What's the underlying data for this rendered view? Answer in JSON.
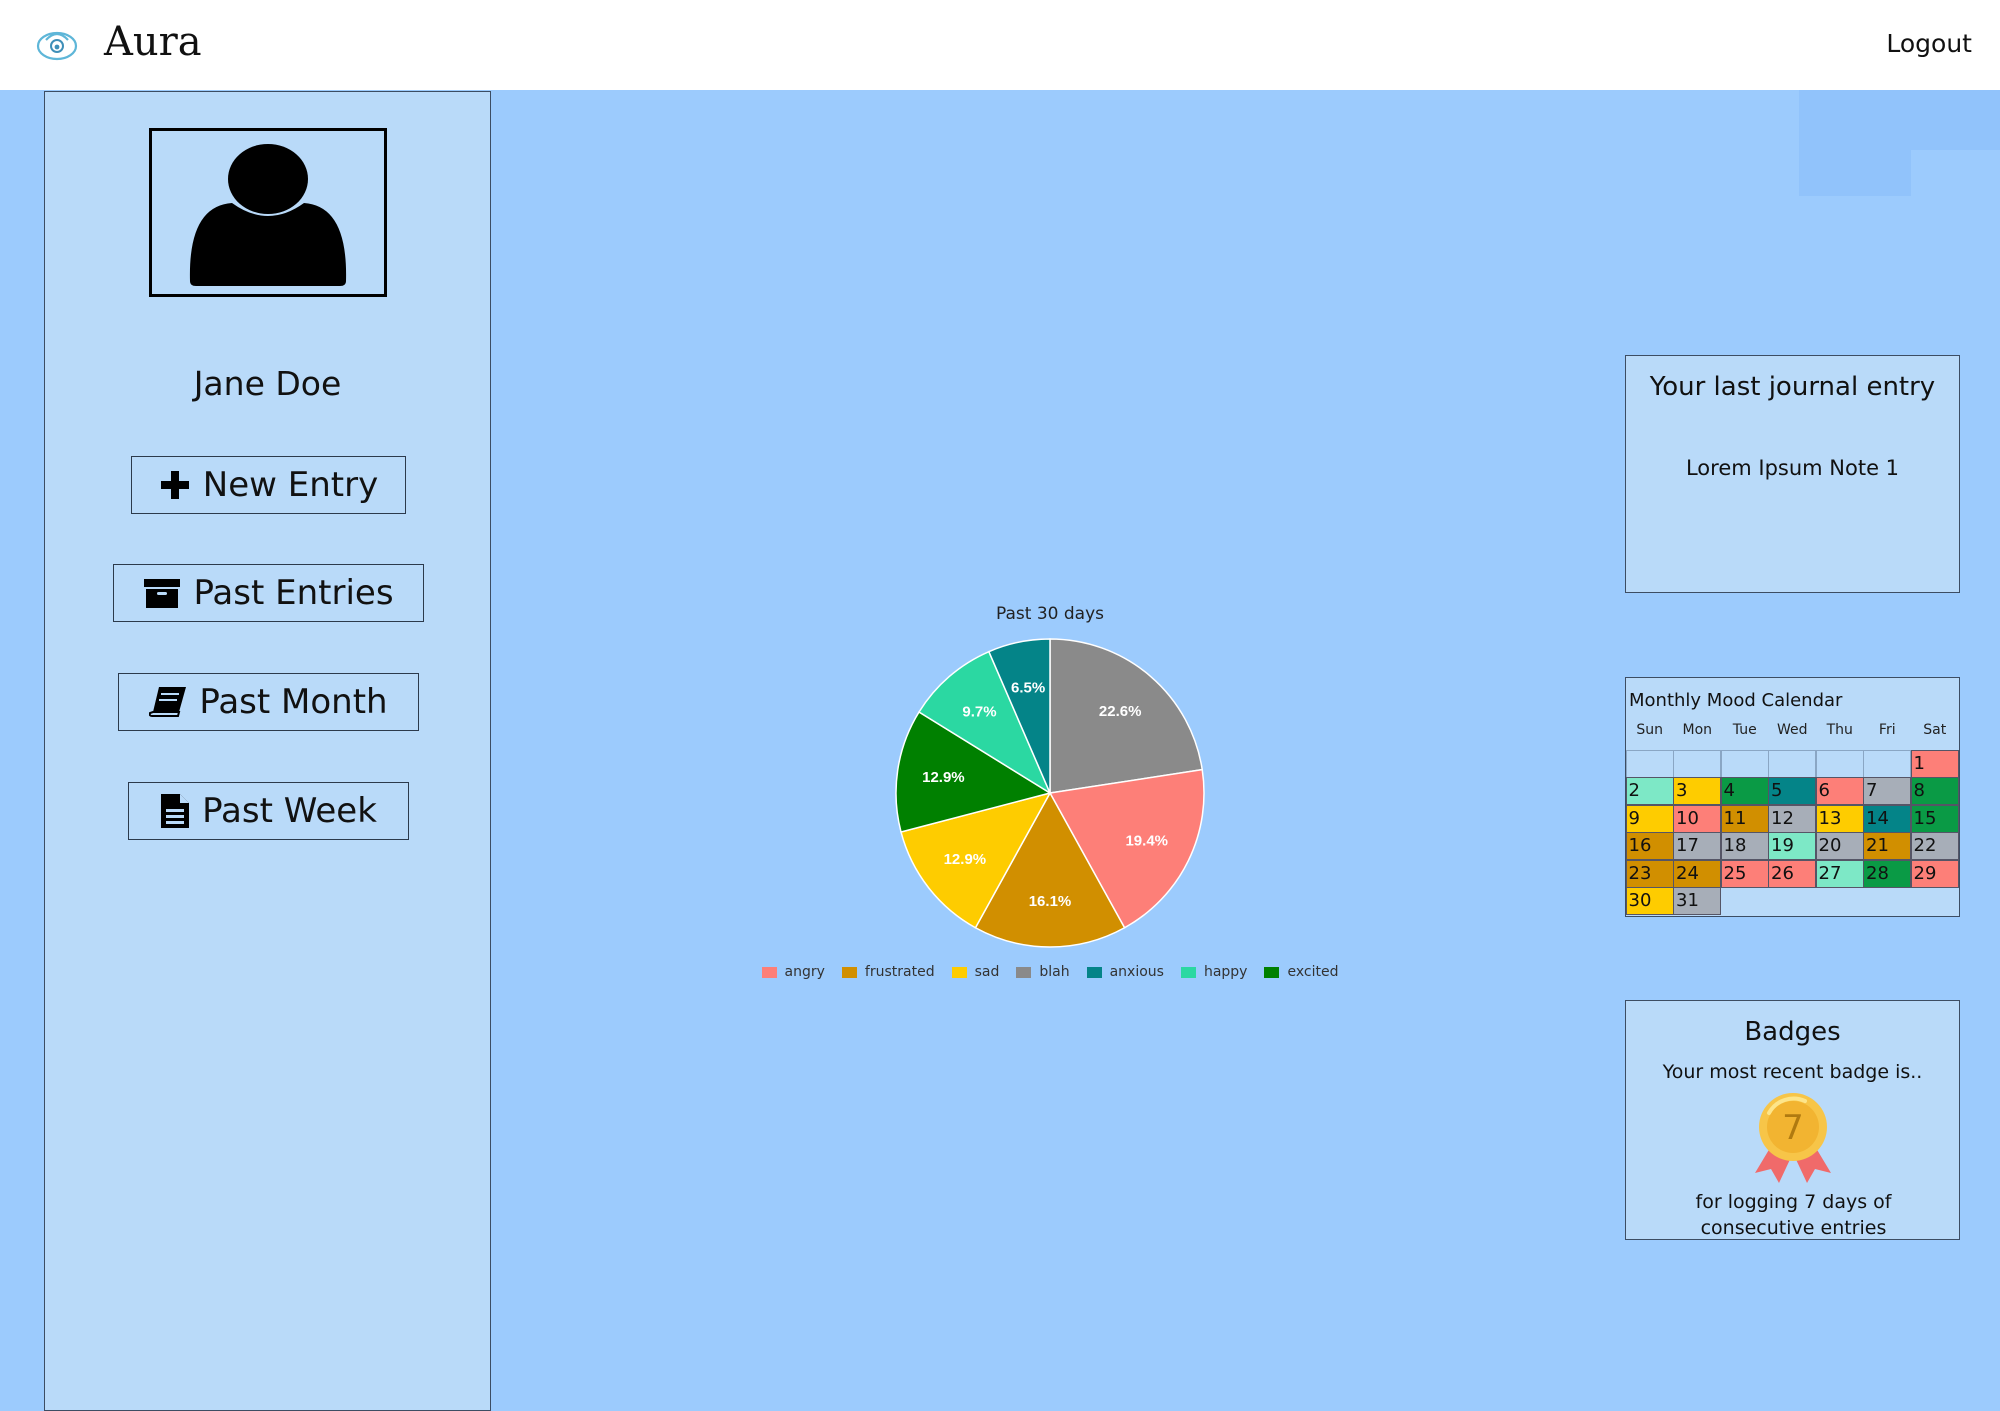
{
  "app": {
    "brand": "Aura",
    "logout_label": "Logout"
  },
  "sidebar": {
    "username": "Jane Doe",
    "nav": [
      {
        "label": "New Entry",
        "icon": "plus-icon"
      },
      {
        "label": "Past Entries",
        "icon": "archive-icon"
      },
      {
        "label": "Past Month",
        "icon": "book-icon"
      },
      {
        "label": "Past Week",
        "icon": "document-icon"
      }
    ]
  },
  "chart_data": {
    "type": "pie",
    "title": "Past 30 days",
    "legend_position": "bottom",
    "categories": [
      "angry",
      "frustrated",
      "sad",
      "blah",
      "anxious",
      "happy",
      "excited"
    ],
    "values": [
      19.4,
      16.1,
      12.9,
      22.6,
      6.5,
      9.7,
      12.9
    ],
    "value_labels": [
      "19.4%",
      "16.1%",
      "12.9%",
      "22.6%",
      "6.5%",
      "9.7%",
      "12.9%"
    ],
    "colors": [
      "#fd7f78",
      "#d18f00",
      "#fecc00",
      "#8a8a8a",
      "#048488",
      "#2bd8a2",
      "#008000"
    ],
    "slice_order": [
      "blah",
      "angry",
      "frustrated",
      "sad",
      "excited",
      "happy",
      "anxious"
    ]
  },
  "journal": {
    "title": "Your last journal entry",
    "note": "Lorem Ipsum Note 1"
  },
  "calendar": {
    "title": "Monthly Mood Calendar",
    "weekdays": [
      "Sun",
      "Mon",
      "Tue",
      "Wed",
      "Thu",
      "Fri",
      "Sat"
    ],
    "first_weekday_index": 6,
    "mood_colors": {
      "angry": "#fd7f78",
      "frustrated": "#d18f00",
      "sad": "#fecc00",
      "blah": "#a7aeb8",
      "anxious": "#048488",
      "happy": "#7de8c6",
      "excited": "#0a9a45"
    },
    "days": [
      {
        "day": "1",
        "mood": "angry"
      },
      {
        "day": "2",
        "mood": "happy"
      },
      {
        "day": "3",
        "mood": "sad"
      },
      {
        "day": "4",
        "mood": "excited"
      },
      {
        "day": "5",
        "mood": "anxious"
      },
      {
        "day": "6",
        "mood": "angry"
      },
      {
        "day": "7",
        "mood": "blah"
      },
      {
        "day": "8",
        "mood": "excited"
      },
      {
        "day": "9",
        "mood": "sad"
      },
      {
        "day": "10",
        "mood": "angry"
      },
      {
        "day": "11",
        "mood": "frustrated"
      },
      {
        "day": "12",
        "mood": "blah"
      },
      {
        "day": "13",
        "mood": "sad"
      },
      {
        "day": "14",
        "mood": "anxious"
      },
      {
        "day": "15",
        "mood": "excited"
      },
      {
        "day": "16",
        "mood": "frustrated"
      },
      {
        "day": "17",
        "mood": "blah"
      },
      {
        "day": "18",
        "mood": "blah"
      },
      {
        "day": "19",
        "mood": "happy"
      },
      {
        "day": "20",
        "mood": "blah"
      },
      {
        "day": "21",
        "mood": "frustrated"
      },
      {
        "day": "22",
        "mood": "blah"
      },
      {
        "day": "23",
        "mood": "frustrated"
      },
      {
        "day": "24",
        "mood": "frustrated"
      },
      {
        "day": "25",
        "mood": "angry"
      },
      {
        "day": "26",
        "mood": "angry"
      },
      {
        "day": "27",
        "mood": "happy"
      },
      {
        "day": "28",
        "mood": "excited"
      },
      {
        "day": "29",
        "mood": "angry"
      },
      {
        "day": "30",
        "mood": "sad"
      },
      {
        "day": "31",
        "mood": "blah"
      }
    ]
  },
  "badges": {
    "title": "Badges",
    "subtitle": "Your most recent badge is..",
    "badge_number": "7",
    "description": "for logging 7 days of consecutive entries"
  }
}
